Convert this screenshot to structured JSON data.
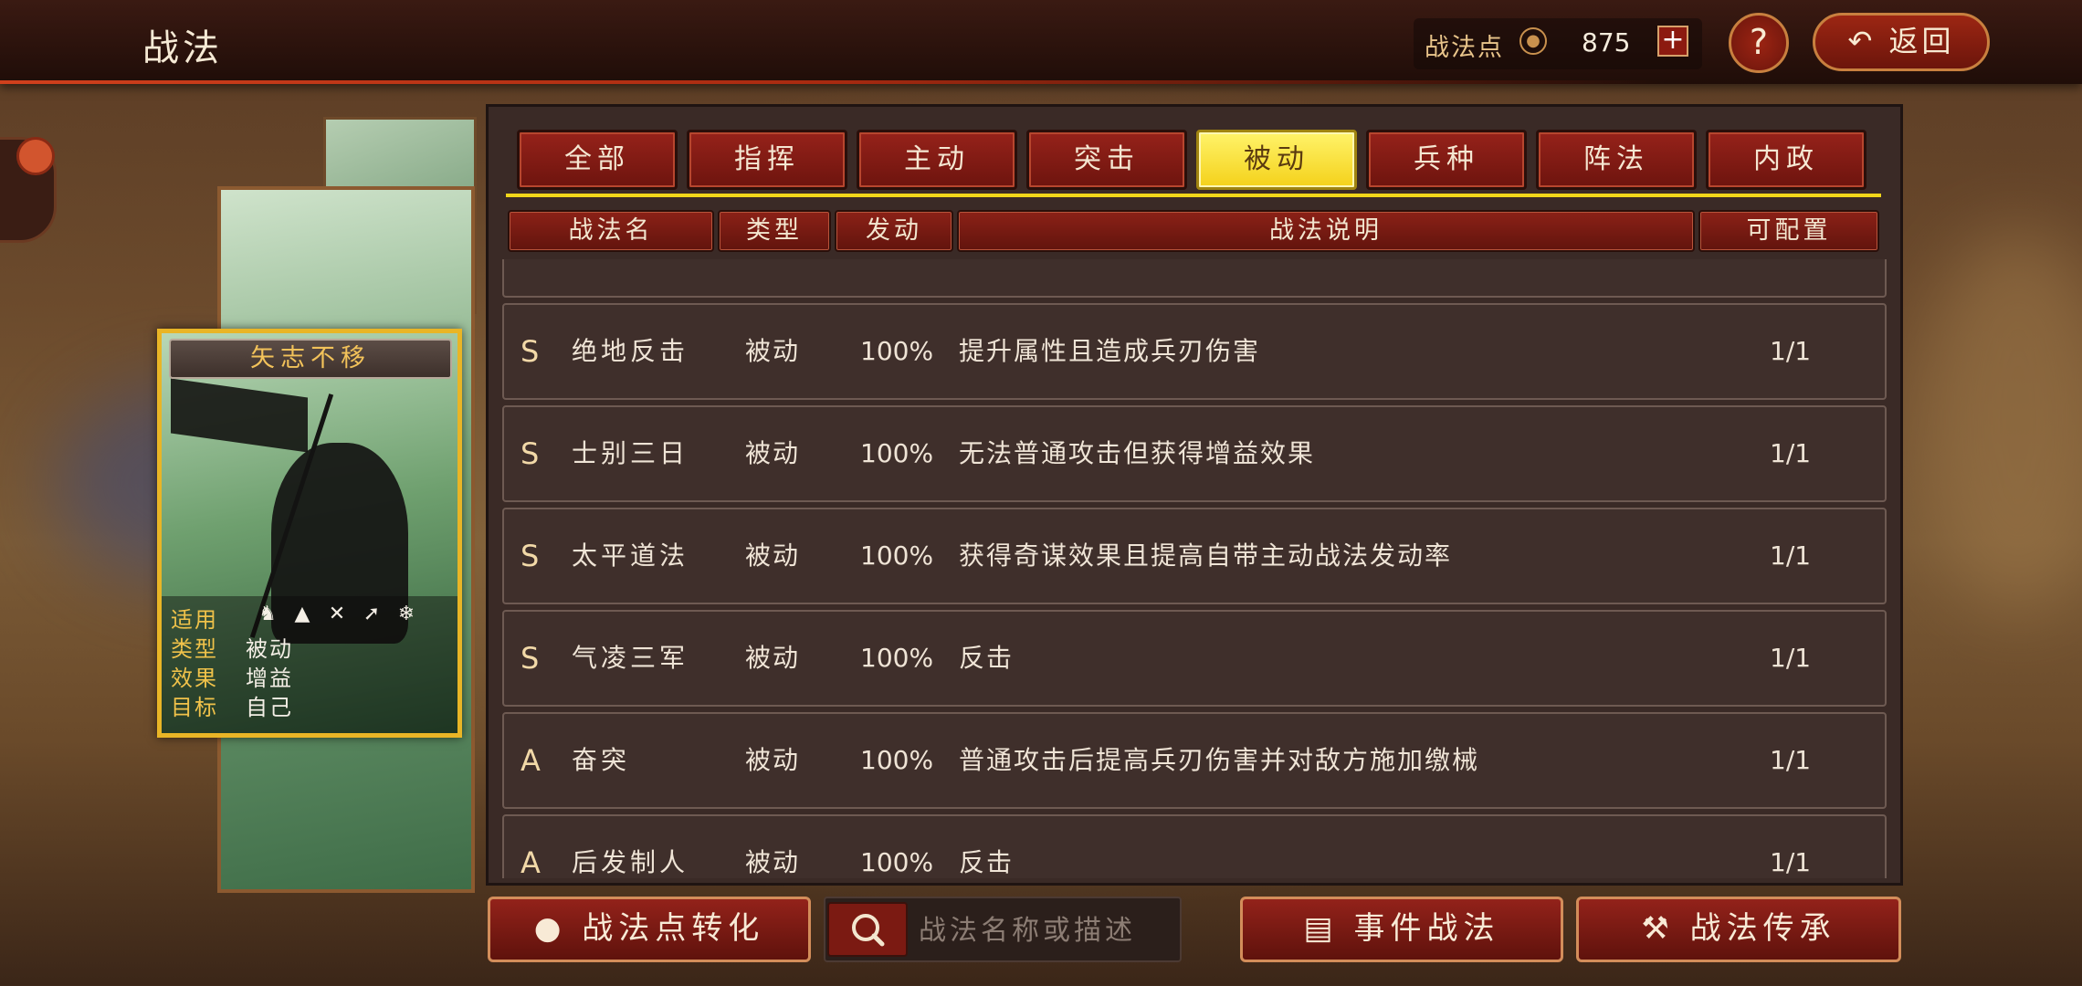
{
  "header": {
    "title": "战法",
    "points_label": "战法点",
    "points_value": "875",
    "plus_label": "+",
    "help_label": "?",
    "back_label": "返回"
  },
  "card": {
    "name": "矢志不移",
    "rows": [
      {
        "key": "适用",
        "value": ""
      },
      {
        "key": "类型",
        "value": "被动"
      },
      {
        "key": "效果",
        "value": "增益"
      },
      {
        "key": "目标",
        "value": "自己"
      }
    ],
    "unit_icons": [
      "cavalry-icon",
      "shield-icon",
      "bow-icon",
      "spear-icon",
      "wheel-icon"
    ]
  },
  "tabs": [
    "全部",
    "指挥",
    "主动",
    "突击",
    "被动",
    "兵种",
    "阵法",
    "内政"
  ],
  "active_tab": "被动",
  "table": {
    "headers": [
      "战法名",
      "类型",
      "发动",
      "战法说明",
      "可配置"
    ],
    "rows": [
      {
        "rank": "S",
        "name": "绝地反击",
        "type": "被动",
        "rate": "100%",
        "desc": "提升属性且造成兵刃伤害",
        "conf": "1/1"
      },
      {
        "rank": "S",
        "name": "士别三日",
        "type": "被动",
        "rate": "100%",
        "desc": "无法普通攻击但获得增益效果",
        "conf": "1/1"
      },
      {
        "rank": "S",
        "name": "太平道法",
        "type": "被动",
        "rate": "100%",
        "desc": "获得奇谋效果且提高自带主动战法发动率",
        "conf": "1/1"
      },
      {
        "rank": "S",
        "name": "气凌三军",
        "type": "被动",
        "rate": "100%",
        "desc": "反击",
        "conf": "1/1"
      },
      {
        "rank": "A",
        "name": "奋突",
        "type": "被动",
        "rate": "100%",
        "desc": "普通攻击后提高兵刃伤害并对敌方施加缴械",
        "conf": "1/1"
      },
      {
        "rank": "A",
        "name": "后发制人",
        "type": "被动",
        "rate": "100%",
        "desc": "反击",
        "conf": "1/1"
      }
    ]
  },
  "bottom": {
    "convert_label": "战法点转化",
    "search_placeholder": "战法名称或描述",
    "event_label": "事件战法",
    "inherit_label": "战法传承"
  },
  "colors": {
    "accent_gold": "#f4d11a",
    "button_red": "#8c1a10",
    "card_border": "#e9b526"
  }
}
